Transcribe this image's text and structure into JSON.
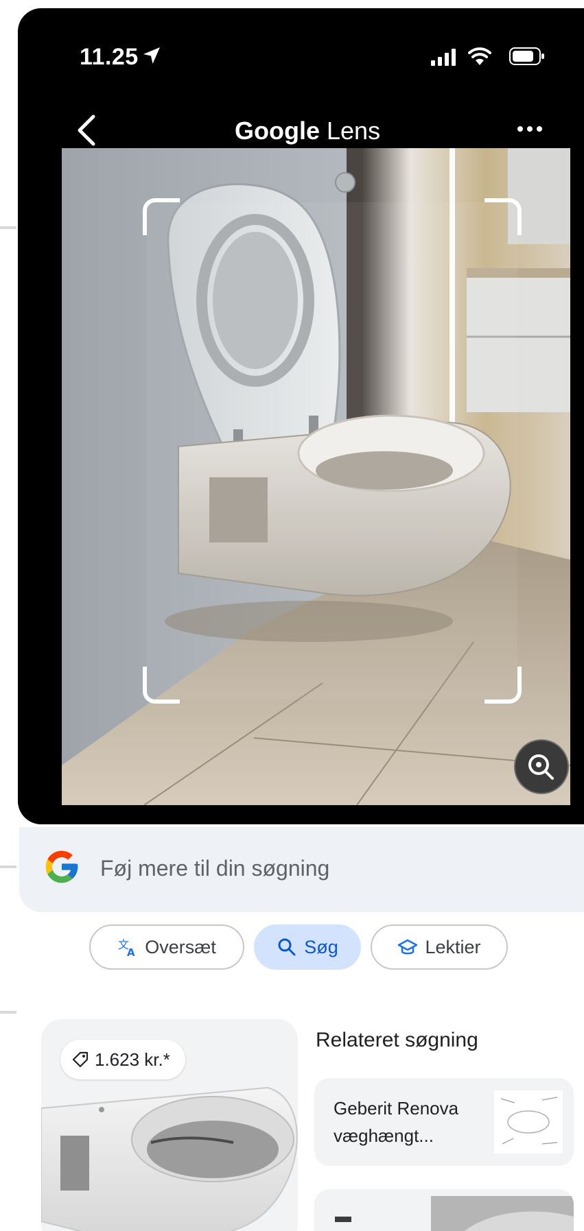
{
  "status_bar": {
    "time": "11.25",
    "icons": [
      "location-arrow-icon",
      "cellular-signal-icon",
      "wifi-icon",
      "battery-icon"
    ]
  },
  "header": {
    "back_icon": "chevron-left-icon",
    "title_brand": "Google",
    "title_product": "Lens",
    "more_icon": "more-horizontal-icon"
  },
  "viewfinder": {
    "visual_search_icon": "lens-search-icon"
  },
  "search": {
    "placeholder": "Føj mere til din søgning",
    "logo_icon": "google-g-icon"
  },
  "modes": [
    {
      "label": "Oversæt",
      "icon": "translate-icon",
      "active": false
    },
    {
      "label": "Søg",
      "icon": "search-icon",
      "active": true
    },
    {
      "label": "Lektier",
      "icon": "graduation-cap-icon",
      "active": false
    }
  ],
  "results": {
    "product": {
      "price": "1.623 kr.*",
      "price_icon": "price-tag-icon"
    },
    "related_title": "Relateret søgning",
    "related": [
      {
        "label": "Geberit Renova væghængt..."
      }
    ]
  },
  "colors": {
    "frame": "#000000",
    "active_chip_bg": "#d3e3fd",
    "active_chip_text": "#0b57d0",
    "search_bg": "#eef1f5",
    "card_bg": "#f1f3f4"
  }
}
